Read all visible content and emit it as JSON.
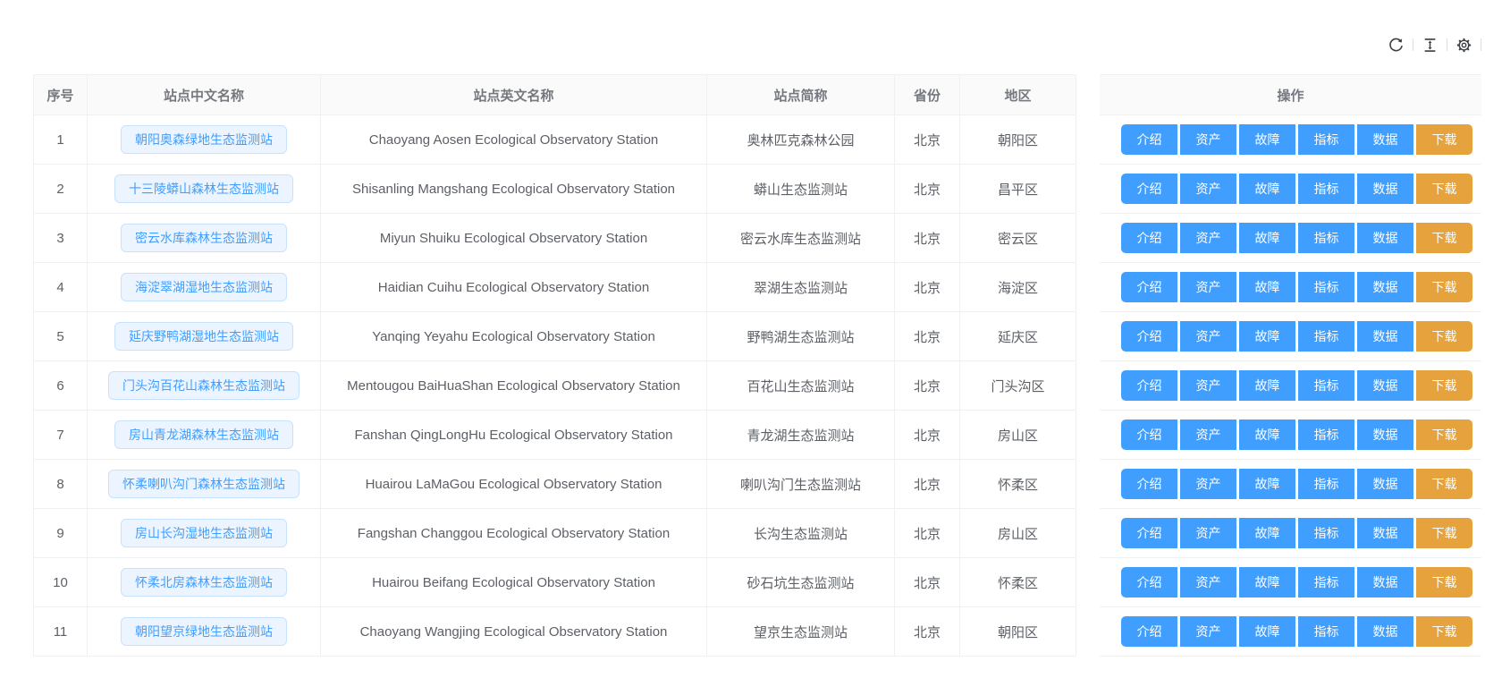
{
  "toolbar": {
    "icons": [
      {
        "key": "reload",
        "name": "reload-icon"
      },
      {
        "key": "density",
        "name": "column-height-icon"
      },
      {
        "key": "settings",
        "name": "gear-icon"
      }
    ]
  },
  "colors": {
    "primary": "#409eff",
    "warning": "#e6a23c",
    "pill_bg": "#ecf5ff",
    "pill_border": "#c6e2ff",
    "header_bg": "#fafafa",
    "border": "#f0f0f0"
  },
  "table": {
    "columns": [
      {
        "key": "index",
        "label": "序号"
      },
      {
        "key": "name_zh",
        "label": "站点中文名称"
      },
      {
        "key": "name_en",
        "label": "站点英文名称"
      },
      {
        "key": "abbr",
        "label": "站点简称"
      },
      {
        "key": "province",
        "label": "省份"
      },
      {
        "key": "region",
        "label": "地区"
      }
    ],
    "action_label": "操作",
    "action_buttons": [
      {
        "key": "intro",
        "label": "介绍",
        "type": "primary"
      },
      {
        "key": "assets",
        "label": "资产",
        "type": "primary"
      },
      {
        "key": "faults",
        "label": "故障",
        "type": "primary"
      },
      {
        "key": "metrics",
        "label": "指标",
        "type": "primary"
      },
      {
        "key": "data",
        "label": "数据",
        "type": "primary"
      },
      {
        "key": "download",
        "label": "下载",
        "type": "warning"
      }
    ],
    "rows": [
      {
        "index": "1",
        "name_zh": "朝阳奥森绿地生态监测站",
        "name_en": "Chaoyang Aosen Ecological Observatory Station",
        "abbr": "奥林匹克森林公园",
        "province": "北京",
        "region": "朝阳区"
      },
      {
        "index": "2",
        "name_zh": "十三陵蟒山森林生态监测站",
        "name_en": "Shisanling Mangshang Ecological Observatory Station",
        "abbr": "蟒山生态监测站",
        "province": "北京",
        "region": "昌平区"
      },
      {
        "index": "3",
        "name_zh": "密云水库森林生态监测站",
        "name_en": "Miyun Shuiku Ecological Observatory Station",
        "abbr": "密云水库生态监测站",
        "province": "北京",
        "region": "密云区"
      },
      {
        "index": "4",
        "name_zh": "海淀翠湖湿地生态监测站",
        "name_en": "Haidian Cuihu Ecological Observatory Station",
        "abbr": "翠湖生态监测站",
        "province": "北京",
        "region": "海淀区"
      },
      {
        "index": "5",
        "name_zh": "延庆野鸭湖湿地生态监测站",
        "name_en": "Yanqing Yeyahu Ecological Observatory Station",
        "abbr": "野鸭湖生态监测站",
        "province": "北京",
        "region": "延庆区"
      },
      {
        "index": "6",
        "name_zh": "门头沟百花山森林生态监测站",
        "name_en": "Mentougou BaiHuaShan Ecological Observatory Station",
        "abbr": "百花山生态监测站",
        "province": "北京",
        "region": "门头沟区"
      },
      {
        "index": "7",
        "name_zh": "房山青龙湖森林生态监测站",
        "name_en": "Fanshan QingLongHu Ecological Observatory Station",
        "abbr": "青龙湖生态监测站",
        "province": "北京",
        "region": "房山区"
      },
      {
        "index": "8",
        "name_zh": "怀柔喇叭沟门森林生态监测站",
        "name_en": "Huairou LaMaGou Ecological Observatory Station",
        "abbr": "喇叭沟门生态监测站",
        "province": "北京",
        "region": "怀柔区"
      },
      {
        "index": "9",
        "name_zh": "房山长沟湿地生态监测站",
        "name_en": "Fangshan Changgou Ecological Observatory Station",
        "abbr": "长沟生态监测站",
        "province": "北京",
        "region": "房山区"
      },
      {
        "index": "10",
        "name_zh": "怀柔北房森林生态监测站",
        "name_en": "Huairou Beifang Ecological Observatory Station",
        "abbr": "砂石坑生态监测站",
        "province": "北京",
        "region": "怀柔区"
      },
      {
        "index": "11",
        "name_zh": "朝阳望京绿地生态监测站",
        "name_en": "Chaoyang Wangjing Ecological Observatory Station",
        "abbr": "望京生态监测站",
        "province": "北京",
        "region": "朝阳区"
      }
    ]
  }
}
